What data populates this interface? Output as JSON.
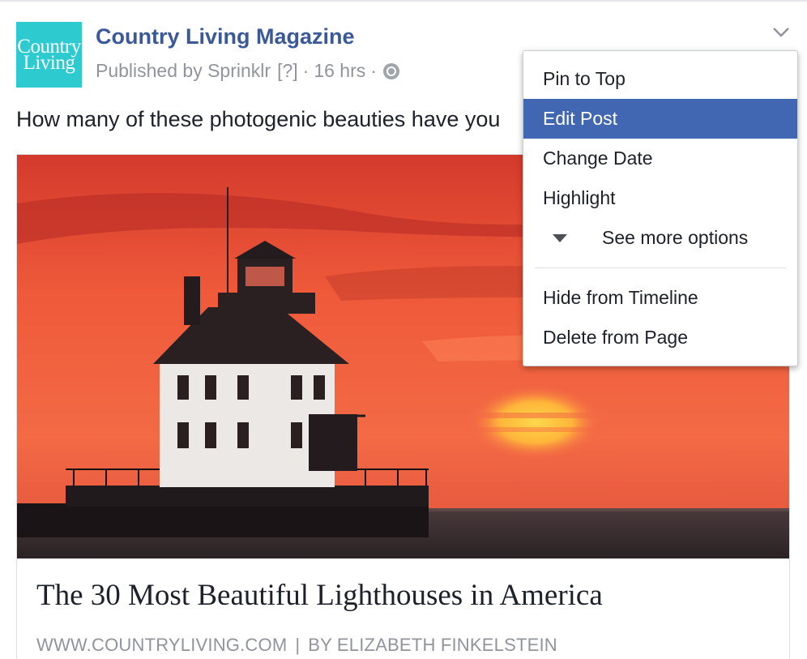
{
  "post": {
    "page_name": "Country Living Magazine",
    "avatar_text": {
      "line1": "Country",
      "line2": "Living"
    },
    "meta": {
      "publisher": "Published by Sprinklr",
      "help": "[?]",
      "separator": "·",
      "time": "16 hrs",
      "privacy_icon": "globe-icon"
    },
    "text": "How many of these photogenic beauties have you"
  },
  "link": {
    "headline": "The 30 Most Beautiful Lighthouses in America",
    "domain": "WWW.COUNTRYLIVING.COM",
    "divider": "|",
    "byline": "BY ELIZABETH FINKELSTEIN"
  },
  "menu": {
    "items": [
      {
        "label": "Pin to Top"
      },
      {
        "label": "Edit Post",
        "state": "highlighted"
      },
      {
        "label": "Change Date"
      },
      {
        "label": "Highlight"
      },
      {
        "label": "See more options"
      },
      {
        "label": "Hide from Timeline"
      },
      {
        "label": "Delete from Page"
      }
    ]
  },
  "colors": {
    "brand_blue": "#3b5998",
    "menu_highlight": "#4267b2",
    "avatar_bg": "#2dcbd0",
    "muted_text": "#90949c"
  }
}
